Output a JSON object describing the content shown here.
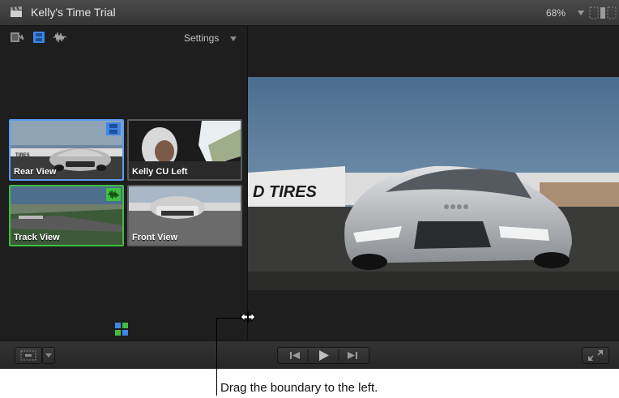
{
  "window": {
    "title": "Kelly's Time Trial",
    "zoom": "68%",
    "title_icon": "clapperboard-icon"
  },
  "angle_panel": {
    "toolbar_icons": [
      "video-audio-switch-icon",
      "video-only-icon",
      "audio-only-icon"
    ],
    "settings_label": "Settings",
    "angles": [
      {
        "label": "Rear View",
        "state": "active-video",
        "badge": "filmstrip-icon",
        "highlight": "#5a9cf0"
      },
      {
        "label": "Kelly CU Left",
        "state": "inactive"
      },
      {
        "label": "Track View",
        "state": "active-audio",
        "badge": "waveform-icon",
        "highlight": "#3fbf3f"
      },
      {
        "label": "Front View",
        "state": "inactive"
      }
    ],
    "bank_icon": "angle-bank-icon"
  },
  "bottom_bar": {
    "buttons": [
      "layout-icon",
      "chevron-down-icon",
      "previous-edit-icon",
      "play-icon",
      "next-edit-icon",
      "fullscreen-icon"
    ]
  },
  "annotation": {
    "caption": "Drag the boundary to the left.",
    "cursor": "resize-cursor-icon"
  }
}
